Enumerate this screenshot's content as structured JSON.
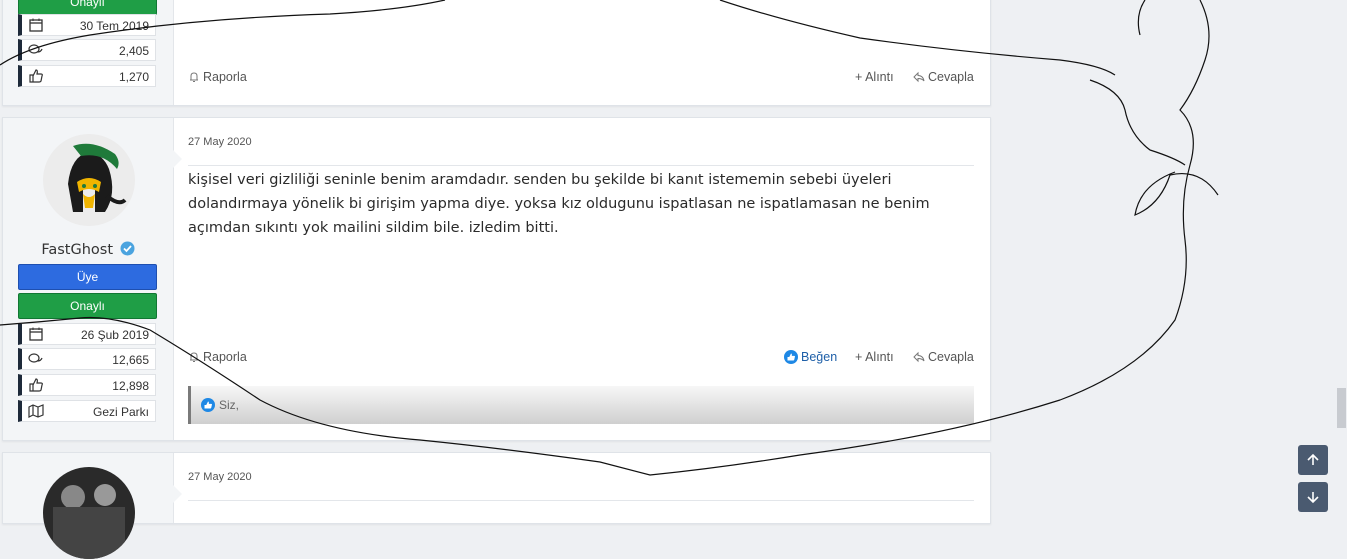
{
  "posts": [
    {
      "badge_onayli": "Onaylı",
      "stats": {
        "joined": "30 Tem 2019",
        "messages": "2,405",
        "reactions": "1,270"
      },
      "actions": {
        "report": "Raporla",
        "quote": "+ Alıntı",
        "reply": "Cevapla"
      }
    },
    {
      "username": "FastGhost",
      "badge_uye": "Üye",
      "badge_onayli": "Onaylı",
      "stats": {
        "joined": "26 Şub 2019",
        "messages": "12,665",
        "reactions": "12,898",
        "location": "Gezi Parkı"
      },
      "date": "27 May 2020",
      "message": "kişisel veri gizliliği seninle benim aramdadır. senden bu şekilde bi kanıt istememin sebebi üyeleri dolandırmaya yönelik bi girişim yapma diye. yoksa kız oldugunu ispatlasan ne ispatlamasan ne benim açımdan sıkıntı yok mailini sildim bile. izledim bitti.",
      "actions": {
        "report": "Raporla",
        "like": "Beğen",
        "quote": "+ Alıntı",
        "reply": "Cevapla"
      },
      "likes_text": "Siz,"
    },
    {
      "date": "27 May 2020"
    }
  ],
  "colors": {
    "badge_blue": "#2d6be0",
    "badge_green": "#1f9e46",
    "accent_like": "#1e88e5"
  },
  "icons": [
    "calendar-icon",
    "messages-icon",
    "thumbs-up-icon",
    "map-icon",
    "bell-icon",
    "reply-icon",
    "like-icon",
    "arrow-up-icon",
    "arrow-down-icon"
  ]
}
